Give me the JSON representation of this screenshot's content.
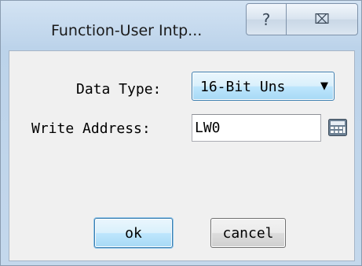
{
  "window": {
    "title": "Function-User Intp...",
    "help_glyph": "?",
    "close_glyph": "⌧"
  },
  "form": {
    "data_type_label": "Data Type:",
    "data_type_value": "16-Bit Uns",
    "write_address_label": "Write Address:",
    "write_address_value": "LW0"
  },
  "buttons": {
    "ok_label": "ok",
    "cancel_label": "cancel"
  },
  "icons": {
    "help": "help-icon",
    "close": "close-icon",
    "dropdown": "chevron-down-icon",
    "keypad": "calculator-icon"
  }
}
